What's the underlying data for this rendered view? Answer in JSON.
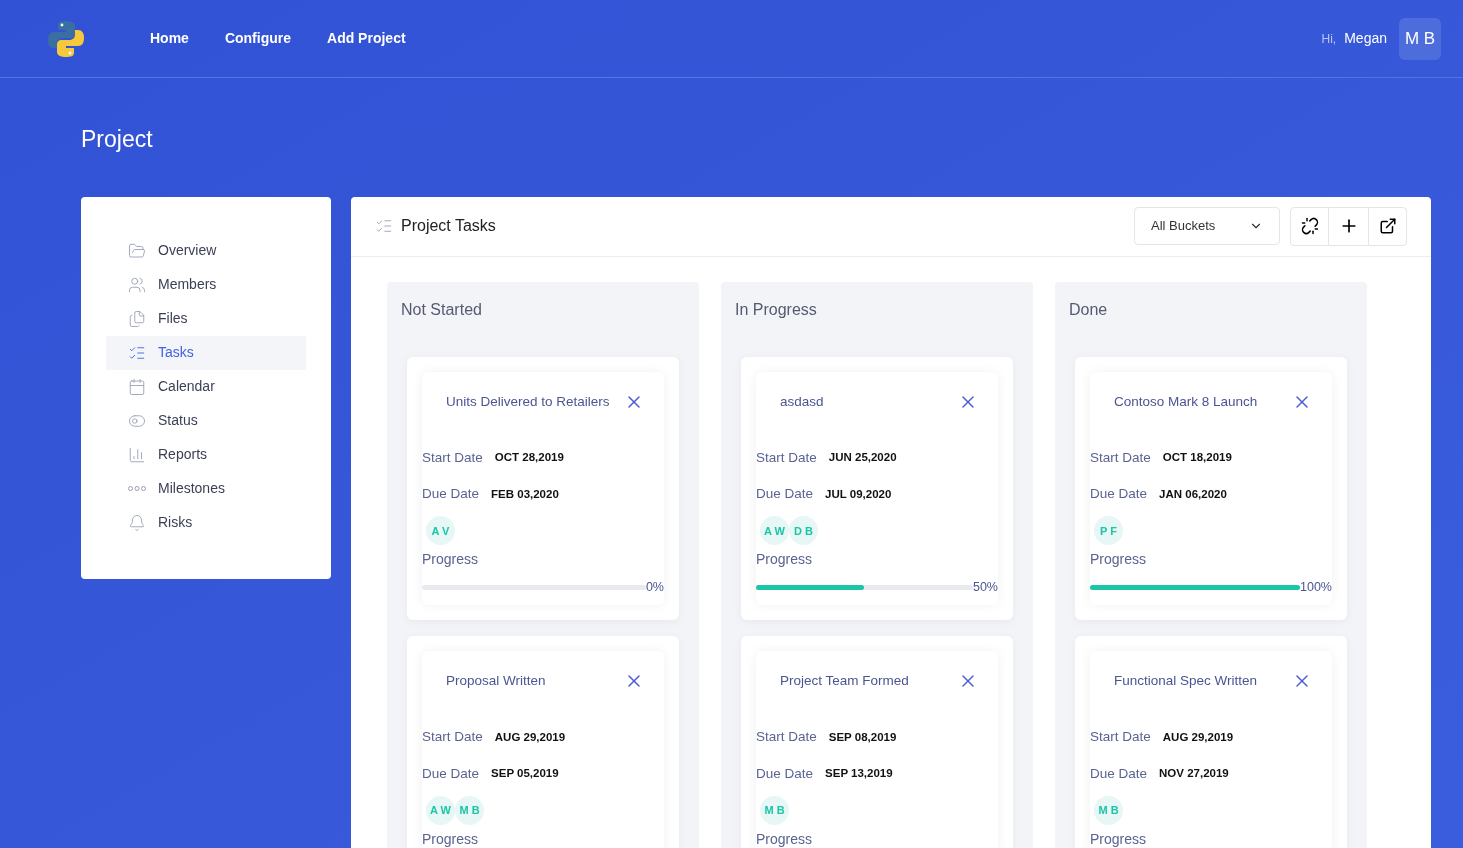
{
  "nav": {
    "links": [
      "Home",
      "Configure",
      "Add Project"
    ],
    "greeting": "Hi,",
    "user_name": "Megan",
    "user_initials": "M B"
  },
  "page_title": "Project",
  "sidebar": {
    "items": [
      {
        "label": "Overview",
        "selected": false
      },
      {
        "label": "Members",
        "selected": false
      },
      {
        "label": "Files",
        "selected": false
      },
      {
        "label": "Tasks",
        "selected": true
      },
      {
        "label": "Calendar",
        "selected": false
      },
      {
        "label": "Status",
        "selected": false
      },
      {
        "label": "Reports",
        "selected": false
      },
      {
        "label": "Milestones",
        "selected": false
      },
      {
        "label": "Risks",
        "selected": false
      }
    ]
  },
  "panel": {
    "title": "Project Tasks",
    "bucket_select": "All Buckets",
    "columns": [
      {
        "title": "Not Started",
        "tasks": [
          {
            "title": "Units Delivered to Retailers",
            "start_label": "Start Date",
            "start": "OCT 28,2019",
            "due_label": "Due Date",
            "due": "FEB 03,2020",
            "assignees": [
              "A V"
            ],
            "progress_label": "Progress",
            "level": 0,
            "reading": "0%"
          },
          {
            "title": "Proposal Written",
            "start_label": "Start Date",
            "start": "AUG 29,2019",
            "due_label": "Due Date",
            "due": "SEP 05,2019",
            "assignees": [
              "A W",
              "M B"
            ],
            "progress_label": "Progress"
          }
        ]
      },
      {
        "title": "In Progress",
        "tasks": [
          {
            "title": "asdasd",
            "start_label": "Start Date",
            "start": "JUN 25,2020",
            "due_label": "Due Date",
            "due": "JUL 09,2020",
            "assignees": [
              "A W",
              "D B"
            ],
            "progress_label": "Progress",
            "level": 0.5,
            "reading": "50%"
          },
          {
            "title": "Project Team Formed",
            "start_label": "Start Date",
            "start": "SEP 08,2019",
            "due_label": "Due Date",
            "due": "SEP 13,2019",
            "assignees": [
              "M B"
            ],
            "progress_label": "Progress"
          }
        ]
      },
      {
        "title": "Done",
        "tasks": [
          {
            "title": "Contoso Mark 8 Launch",
            "start_label": "Start Date",
            "start": "OCT 18,2019",
            "due_label": "Due Date",
            "due": "JAN 06,2020",
            "assignees": [
              "P F"
            ],
            "progress_label": "Progress",
            "level": 1,
            "reading": "100%"
          },
          {
            "title": "Functional Spec Written",
            "start_label": "Start Date",
            "start": "AUG 29,2019",
            "due_label": "Due Date",
            "due": "NOV 27,2019",
            "assignees": [
              "M B"
            ],
            "progress_label": "Progress"
          }
        ]
      }
    ]
  }
}
